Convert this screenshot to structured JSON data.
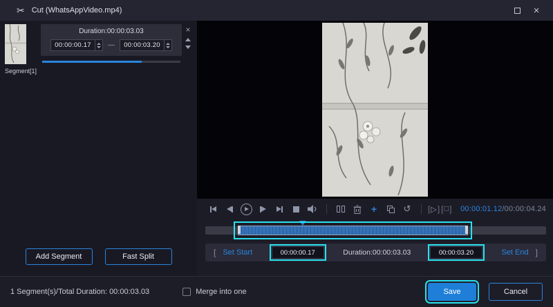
{
  "titlebar": {
    "title": "Cut (WhatsAppVideo.mp4)"
  },
  "icons": {
    "scissors": "✂",
    "close": "×",
    "remove": "×",
    "plus": "+",
    "undo": "↺",
    "dash": "—",
    "play_small": "▷",
    "stop_small": "□",
    "bracket_left": "[",
    "bracket_right": "]"
  },
  "segment_panel": {
    "duration": "Duration:00:00:03.03",
    "start": "00:00:00.17",
    "end": "00:00:03.20",
    "label": "Segment[1]"
  },
  "left_buttons": {
    "add_segment": "Add Segment",
    "fast_split": "Fast Split"
  },
  "player": {
    "current_time": "00:00:01.12",
    "total_time": "/00:00:04.24"
  },
  "trim": {
    "set_start": "Set Start",
    "start": "00:00:00.17",
    "duration": "Duration:00:00:03.03",
    "end": "00:00:03.20",
    "set_end": "Set End"
  },
  "footer": {
    "summary": "1 Segment(s)/Total Duration: 00:00:03.03",
    "merge": "Merge into one",
    "save": "Save",
    "cancel": "Cancel"
  },
  "colors": {
    "accent_blue": "#2a84dd",
    "highlight_cyan": "#2ae2ef",
    "save_fill": "#1f7fd8"
  }
}
